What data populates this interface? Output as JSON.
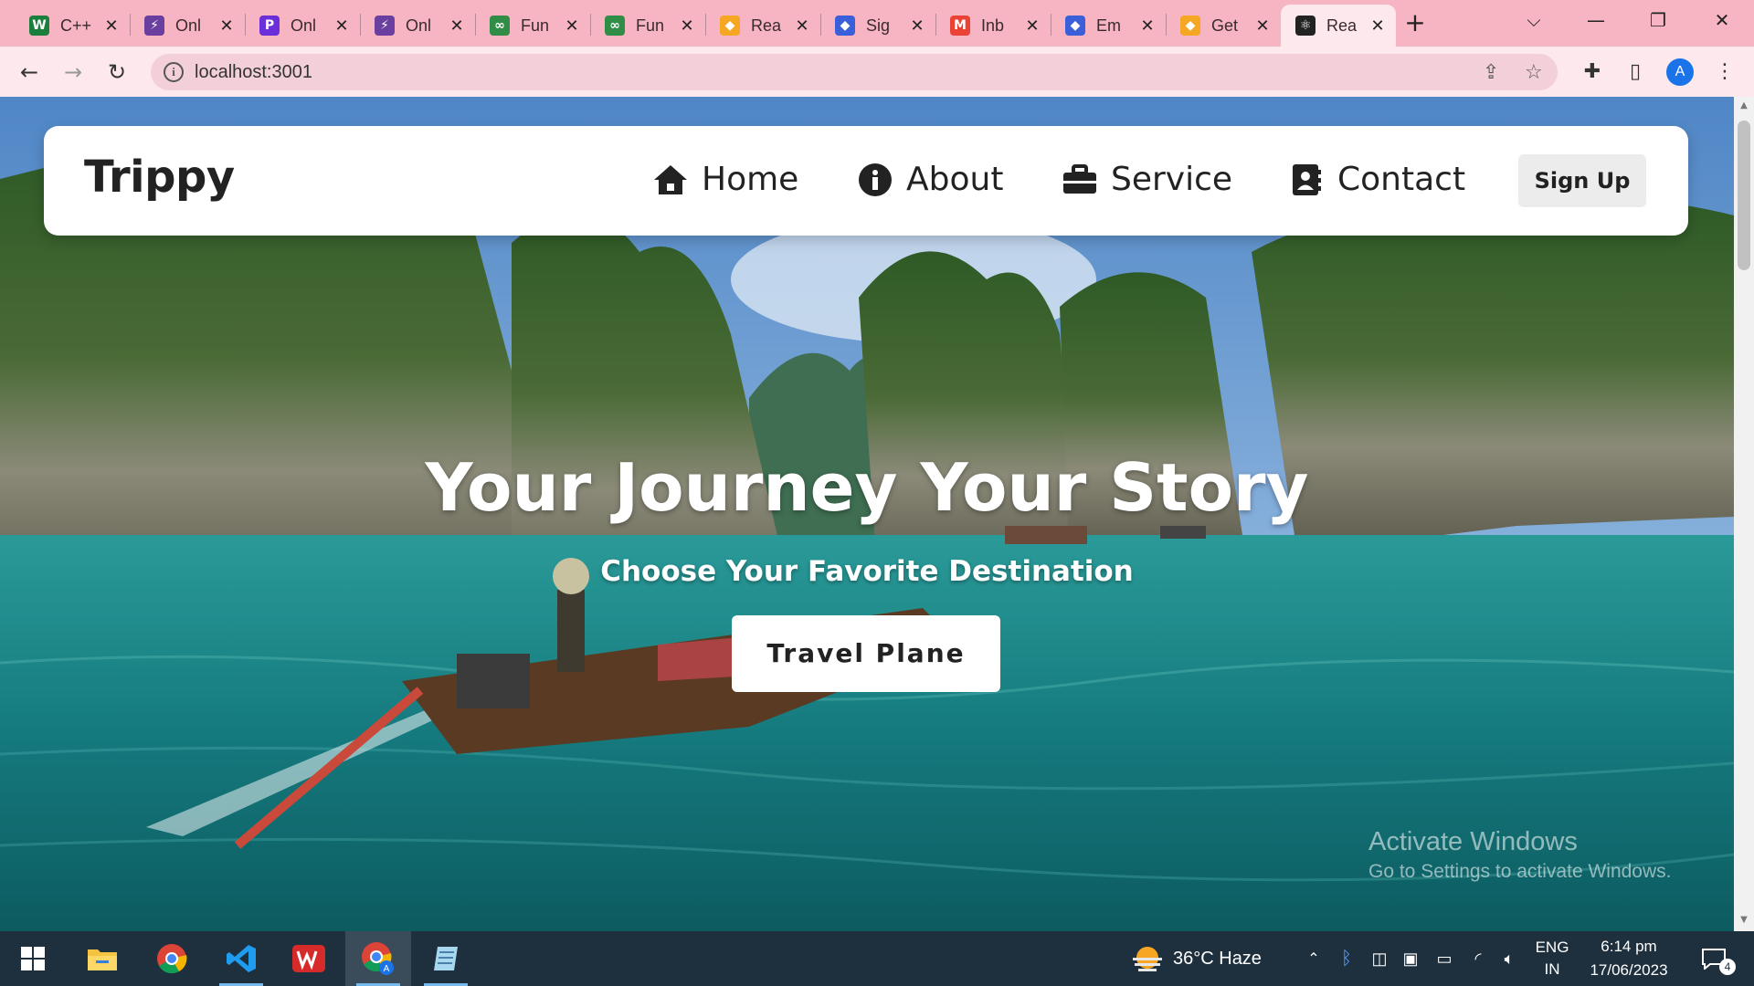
{
  "browser": {
    "tabs": [
      {
        "title": "C++",
        "favicon": "w-icon",
        "color": "#1a7f3a"
      },
      {
        "title": "Onl",
        "favicon": "bolt-icon",
        "color": "#6a3fa0"
      },
      {
        "title": "Onl",
        "favicon": "p-icon",
        "color": "#6a2fd8"
      },
      {
        "title": "Onl",
        "favicon": "bolt-icon",
        "color": "#6a3fa0"
      },
      {
        "title": "Fun",
        "favicon": "gfg-icon",
        "color": "#2f8d46"
      },
      {
        "title": "Fun",
        "favicon": "gfg-icon",
        "color": "#2f8d46"
      },
      {
        "title": "Rea",
        "favicon": "shield-icon",
        "color": "#f5a623"
      },
      {
        "title": "Sig",
        "favicon": "shield-icon",
        "color": "#3b5fd9"
      },
      {
        "title": "Inb",
        "favicon": "gmail-icon",
        "color": "#ea4335"
      },
      {
        "title": "Em",
        "favicon": "shield-icon",
        "color": "#3b5fd9"
      },
      {
        "title": "Get",
        "favicon": "shield-icon",
        "color": "#f5a623"
      },
      {
        "title": "Rea",
        "favicon": "react-icon",
        "color": "#222222",
        "active": true
      }
    ],
    "url": "localhost:3001",
    "profile_initial": "A"
  },
  "site": {
    "logo": "Trippy",
    "nav": {
      "home": "Home",
      "about": "About",
      "service": "Service",
      "contact": "Contact",
      "signup": "Sign Up"
    },
    "hero": {
      "title": "Your Journey Your Story",
      "subtitle": "Choose Your Favorite Destination",
      "button": "Travel Plane"
    }
  },
  "watermark": {
    "line1": "Activate Windows",
    "line2": "Go to Settings to activate Windows."
  },
  "taskbar": {
    "weather": "36°C  Haze",
    "lang_top": "ENG",
    "lang_bottom": "IN",
    "time": "6:14 pm",
    "date": "17/06/2023",
    "notifications": "4"
  },
  "colors": {
    "tabstrip": "#f7b4c2",
    "toolbar": "#fce8ed",
    "taskbar": "#1e2f3d"
  }
}
